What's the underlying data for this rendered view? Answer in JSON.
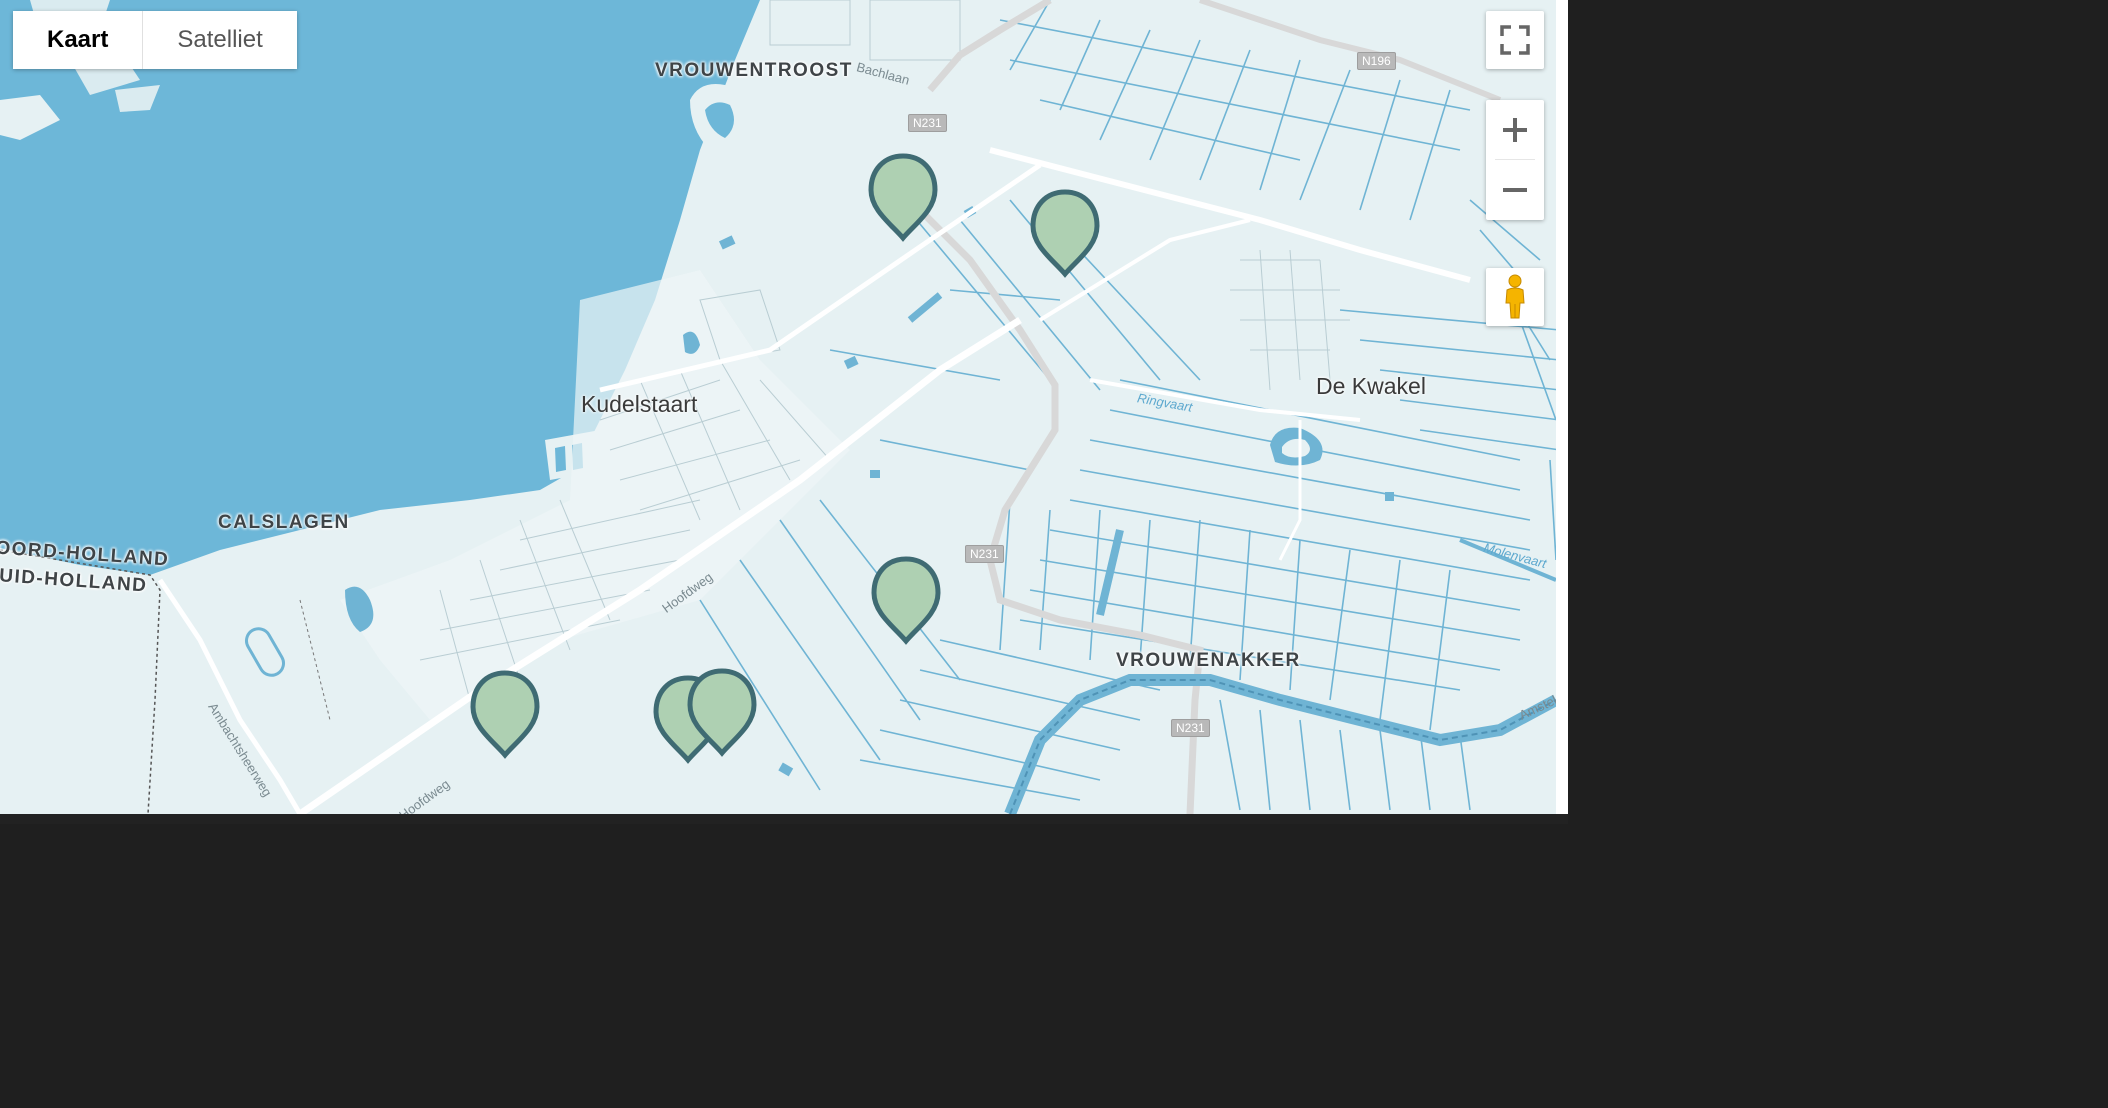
{
  "map_type_control": {
    "map_label": "Kaart",
    "satellite_label": "Satelliet",
    "active": "Kaart"
  },
  "labels": {
    "vrouwentroost": "VROUWENTROOST",
    "bachlaan": "Bachlaan",
    "kudelstaart": "Kudelstaart",
    "calslagen": "CALSLAGEN",
    "noord_holland": "NOORD-HOLLAND",
    "zuid_holland": "ZUID-HOLLAND",
    "de_kwakel": "De Kwakel",
    "ringvaart": "Ringvaart",
    "vrouwenakker": "VROUWENAKKER",
    "hoofdweg": "Hoofdweg",
    "hoofdweg_2": "Hoofdweg",
    "ambachtsheerweg": "Ambachtsheerweg",
    "molenvaart": "Molenvaart",
    "amstel": "Amstel"
  },
  "shields": {
    "n196": "N196",
    "n231_a": "N231",
    "n231_b": "N231",
    "n231_c": "N231"
  },
  "markers": [
    {
      "name": "marker-1"
    },
    {
      "name": "marker-2"
    },
    {
      "name": "marker-3"
    },
    {
      "name": "marker-4"
    },
    {
      "name": "marker-5"
    },
    {
      "name": "marker-6"
    }
  ],
  "colors": {
    "water": "#6db7d8",
    "land": "#e6f1f3",
    "marker_fill": "#aed0b2",
    "marker_stroke": "#3f6b73",
    "road": "#ffffff",
    "highway": "#dcdcdc"
  }
}
